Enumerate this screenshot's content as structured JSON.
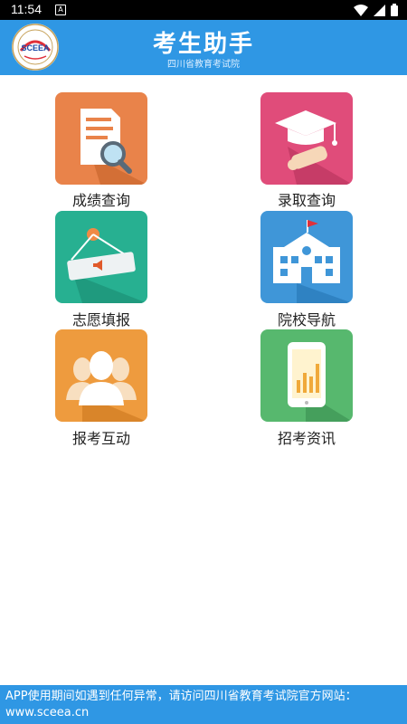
{
  "status_bar": {
    "time": "11:54",
    "icons": [
      "notification-a-icon",
      "wifi-icon",
      "signal-icon",
      "battery-icon"
    ]
  },
  "header": {
    "title": "考生助手",
    "subtitle": "四川省教育考试院",
    "logo_text": "SCEEA"
  },
  "menu": {
    "score_query": {
      "label": "成绩查询",
      "icon": "document-search-icon",
      "color": "#e9834a"
    },
    "admission_query": {
      "label": "录取查询",
      "icon": "graduation-diploma-icon",
      "color": "#e04c7a"
    },
    "volunteer_fill": {
      "label": "志愿填报",
      "icon": "hanging-sign-icon",
      "color": "#27b091"
    },
    "school_nav": {
      "label": "院校导航",
      "icon": "school-building-icon",
      "color": "#3f96d8"
    },
    "exam_interaction": {
      "label": "报考互动",
      "icon": "people-icon",
      "color": "#ee9b3e"
    },
    "exam_news": {
      "label": "招考资讯",
      "icon": "tablet-chart-icon",
      "color": "#57b86e"
    }
  },
  "footer": {
    "notice": "APP使用期间如遇到任何异常，请访问四川省教育考试院官方网站：",
    "url": "www.sceea.cn"
  }
}
